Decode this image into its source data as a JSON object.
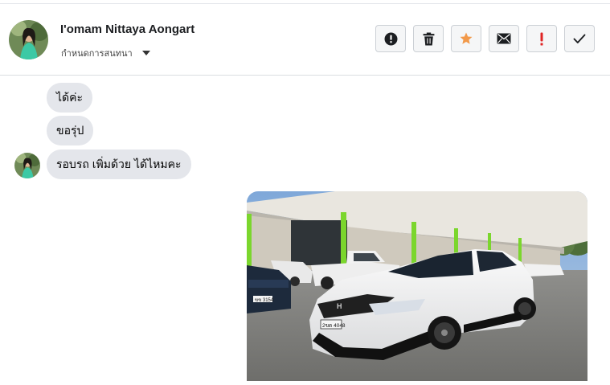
{
  "contact": {
    "name": "I'omam Nittaya Aongart",
    "subtitle": "กำหนดการสนทนา"
  },
  "actions": [
    {
      "icon": "alert-circle-icon",
      "color": "#1c1e21"
    },
    {
      "icon": "trash-icon",
      "color": "#1c1e21"
    },
    {
      "icon": "star-icon",
      "color": "#f2994a"
    },
    {
      "icon": "envelope-icon",
      "color": "#1c1e21"
    },
    {
      "icon": "exclamation-icon",
      "color": "#e02424"
    },
    {
      "icon": "checkmark-icon",
      "color": "#1c1e21"
    }
  ],
  "messages": [
    {
      "text": "ได้ค่ะ"
    },
    {
      "text": "ขอรุ่ป"
    },
    {
      "text": "รอบรถ เพิ่มด้วย ได้ไหมคะ"
    }
  ],
  "photo": {
    "plate_left": "ขข 3154",
    "plate_right": "2ขด 4048"
  },
  "colors": {
    "bubble": "#e4e6eb",
    "star": "#f2994a",
    "exclaim": "#e02424"
  }
}
